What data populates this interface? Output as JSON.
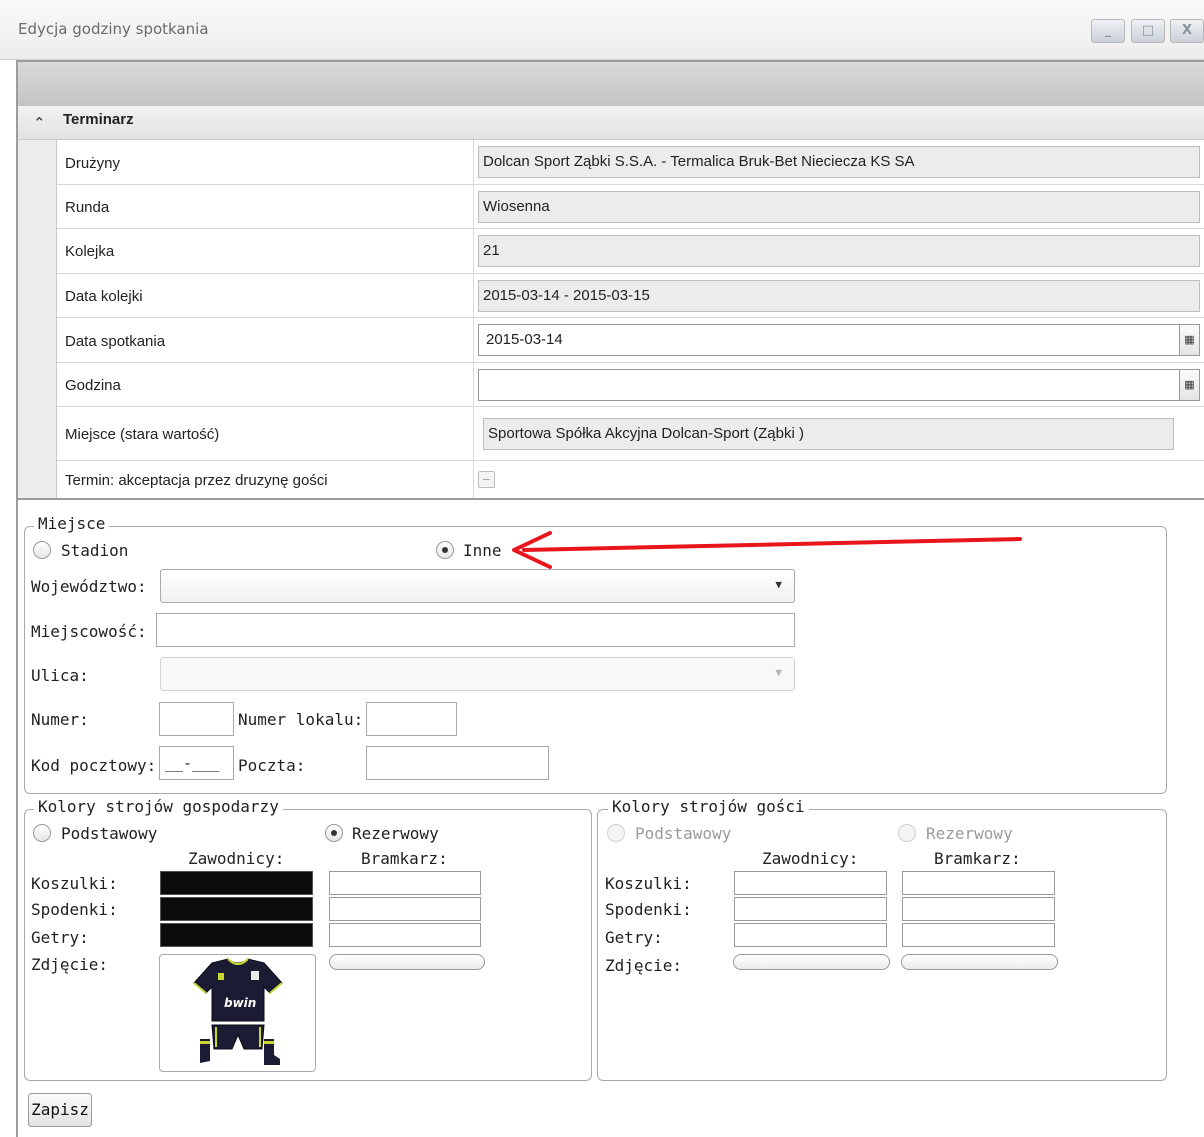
{
  "window": {
    "title": "Edycja godziny spotkania",
    "buttons": {
      "minimize": "_",
      "maximize": "□",
      "close": "X"
    }
  },
  "section": {
    "title": "Terminarz"
  },
  "fields": [
    {
      "label": "Drużyny",
      "value": "Dolcan Sport Ząbki S.S.A. - Termalica Bruk-Bet Nieciecza KS SA"
    },
    {
      "label": "Runda",
      "value": "Wiosenna"
    },
    {
      "label": "Kolejka",
      "value": "21"
    },
    {
      "label": "Data kolejki",
      "value": "2015-03-14 - 2015-03-15"
    },
    {
      "label": "Data spotkania",
      "value": "2015-03-14"
    },
    {
      "label": "Godzina",
      "value": ""
    },
    {
      "label": "Miejsce (stara wartość)",
      "value": "Sportowa Spółka Akcyjna Dolcan-Sport (Ząbki )"
    },
    {
      "label": "Termin: akceptacja przez druzynę gości",
      "value": ""
    }
  ],
  "location": {
    "legend": "Miejsce",
    "radio_stadion": "Stadion",
    "radio_inne": "Inne",
    "selected": "Inne",
    "wojewodztwo_label": "Województwo:",
    "wojewodztwo_value": "",
    "miejscowosc_label": "Miejscowość:",
    "miejscowosc_value": "",
    "ulica_label": "Ulica:",
    "ulica_value": "",
    "numer_label": "Numer:",
    "numer_value": "",
    "numer_lokalu_label": "Numer lokalu:",
    "numer_lokalu_value": "",
    "kod_label": "Kod pocztowy:",
    "kod_value": "__-___",
    "poczta_label": "Poczta:",
    "poczta_value": ""
  },
  "home_kit": {
    "legend": "Kolory strojów gospodarzy",
    "radio_podstawowy": "Podstawowy",
    "radio_rezerwowy": "Rezerwowy",
    "selected": "Rezerwowy",
    "col_players": "Zawodnicy:",
    "col_goalkeeper": "Bramkarz:",
    "row_shirts": "Koszulki:",
    "row_shorts": "Spodenki:",
    "row_socks": "Getry:",
    "row_photo": "Zdjęcie:",
    "jersey_sponsor": "bwin",
    "player_colors": [
      "#0b0b0b",
      "#0b0b0b",
      "#0b0b0b"
    ]
  },
  "away_kit": {
    "legend": "Kolory strojów gości",
    "radio_podstawowy": "Podstawowy",
    "radio_rezerwowy": "Rezerwowy",
    "col_players": "Zawodnicy:",
    "col_goalkeeper": "Bramkarz:",
    "row_shirts": "Koszulki:",
    "row_shorts": "Spodenki:",
    "row_socks": "Getry:",
    "row_photo": "Zdjęcie:"
  },
  "actions": {
    "save": "Zapisz"
  },
  "colors": {
    "annotation_arrow": "#e8151b",
    "kit_player": "#0b0b0b"
  }
}
